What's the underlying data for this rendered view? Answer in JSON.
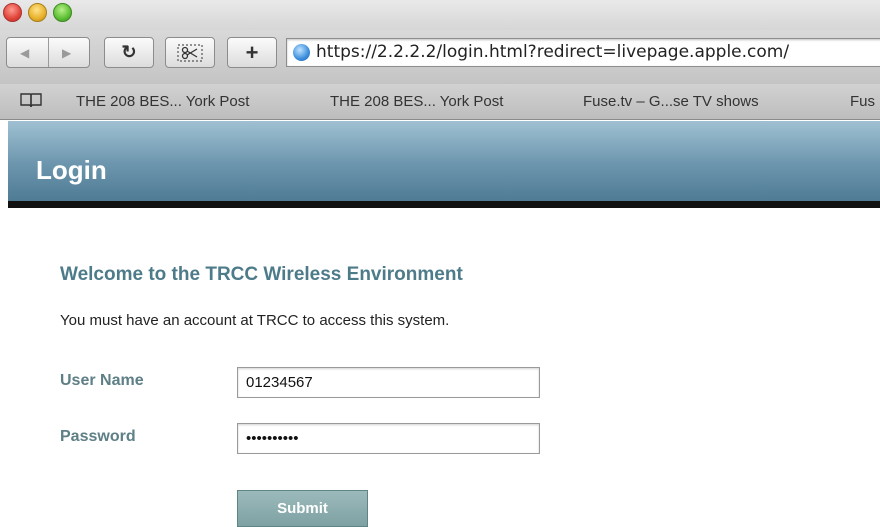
{
  "browser": {
    "url": "https://2.2.2.2/login.html?redirect=livepage.apple.com/",
    "bookmarks": [
      "THE 208 BES... York Post",
      "THE 208 BES... York Post",
      "Fuse.tv – G...se TV shows",
      "Fus"
    ]
  },
  "page": {
    "header_title": "Login",
    "welcome": "Welcome to the TRCC Wireless Environment",
    "notice": "You must have an account at TRCC to access this system.",
    "username": {
      "label": "User Name",
      "value": "01234567"
    },
    "password": {
      "label": "Password",
      "value": "••••••••••"
    },
    "submit_label": "Submit",
    "colors": {
      "header": "#6b95ad",
      "heading_text": "#4d7b8a",
      "label_text": "#5d7f85",
      "submit_bg": "#8fb0b2"
    }
  }
}
